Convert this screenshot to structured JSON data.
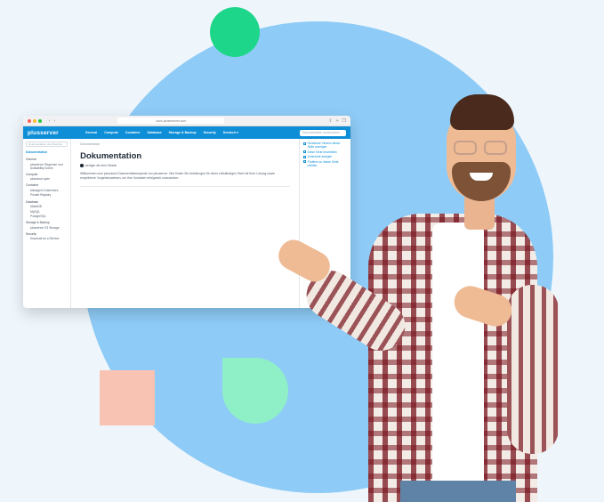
{
  "colors": {
    "background": "#eef6fc",
    "circle": "#8ecbf6",
    "accent_green": "#1ed68a",
    "accent_pink": "#f9c3b4",
    "accent_mint": "#8ff0c8",
    "brand_blue": "#0f8ed8"
  },
  "browser": {
    "url": "docs.pluseserver.com",
    "nav_back": "‹",
    "nav_forward": "›"
  },
  "site": {
    "logo": "plusserver",
    "nav": [
      "General",
      "Compute",
      "Container",
      "Database",
      "Storage & Backup",
      "Security",
      "Deutsch ▾"
    ],
    "search_placeholder": "Dokumentation durchsuchen"
  },
  "sidebar": {
    "search_placeholder": "Dokumentation durchsuchen",
    "active": "Dokumentation",
    "groups": [
      {
        "title": "General",
        "items": [
          "plusserver Regionen und Availability Zones"
        ]
      },
      {
        "title": "Compute",
        "items": [
          "pluscloud open"
        ]
      },
      {
        "title": "Container",
        "items": [
          "Managed Kubernetes",
          "Private Registry"
        ]
      },
      {
        "title": "Database",
        "items": [
          "MariaDB",
          "MySQL",
          "PostgreSQL"
        ]
      },
      {
        "title": "Storage & Backup",
        "items": [
          "plusserver S3 Storage"
        ]
      },
      {
        "title": "Security",
        "items": [
          "Keycloak as a Service"
        ]
      }
    ]
  },
  "main": {
    "breadcrumb": "Dokumentation",
    "title": "Dokumentation",
    "read_time": "weniger als eine Minute",
    "intro": "Willkommen zum pluscloud-Dokumentationsportal von plusserver. Hier finden Sie Anleitungen für einen vollständigen Start mit Ihrer Lösung sowie empfohlene Vorgehensweisen, um Ihre Vorhaben erfolgreich umzusetzen."
  },
  "toc": [
    "Druckbare Version dieser Seite anzeigen",
    "Diese Seite bearbeiten",
    "Unterseite anlegen",
    "Problem zu dieser Seite melden"
  ]
}
